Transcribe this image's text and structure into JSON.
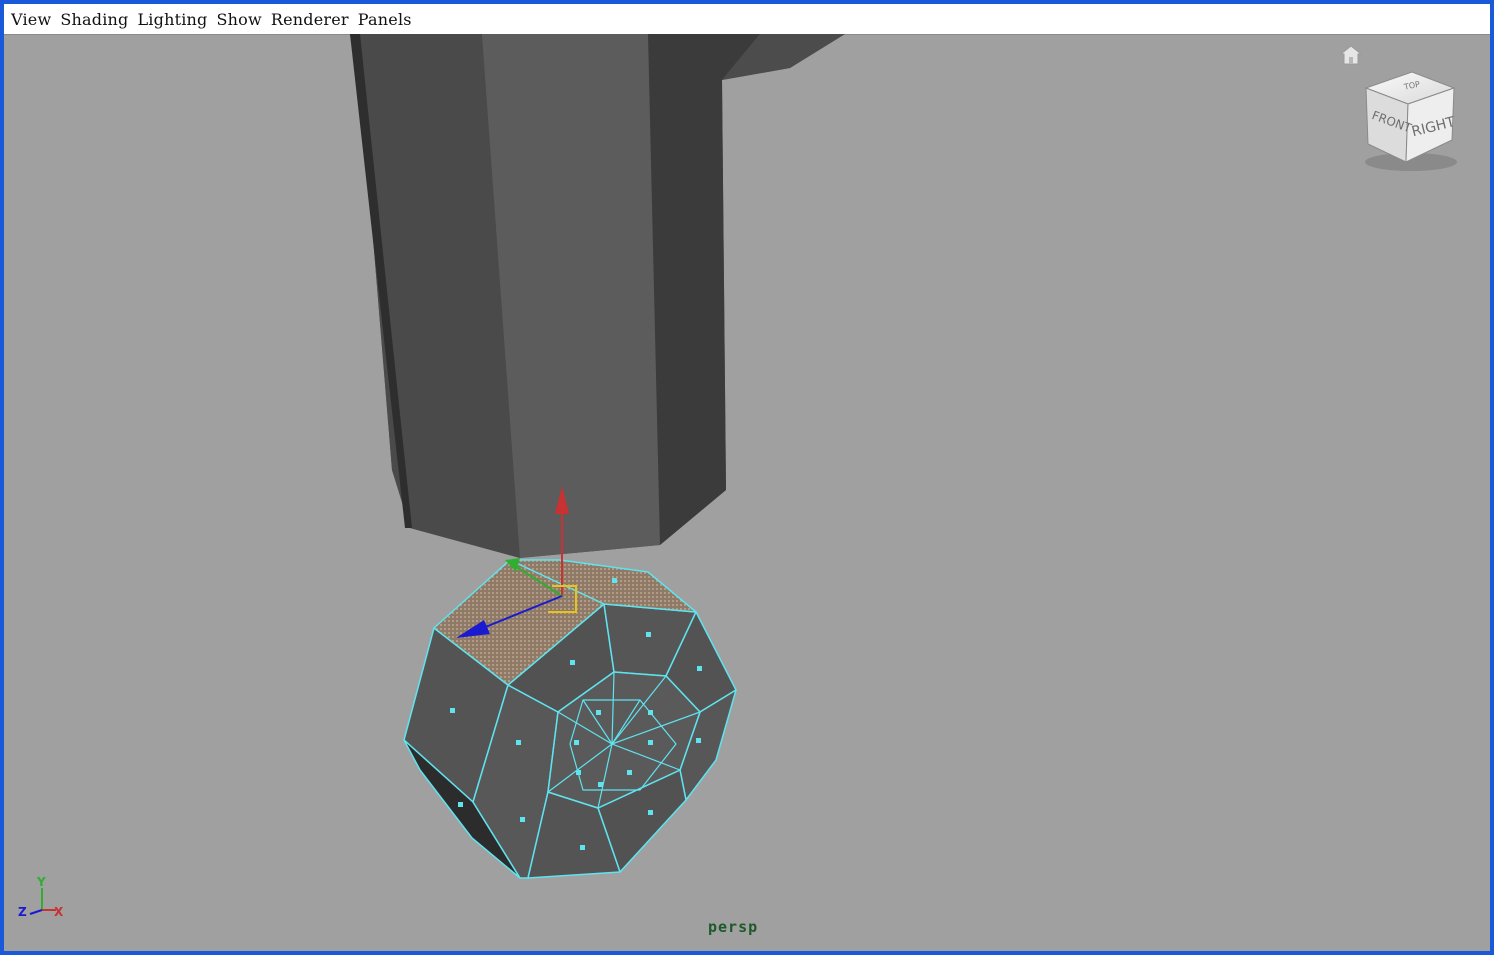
{
  "menubar": {
    "items": [
      "View",
      "Shading",
      "Lighting",
      "Show",
      "Renderer",
      "Panels"
    ]
  },
  "viewport": {
    "camera_name": "persp",
    "background": "#a0a0a0"
  },
  "viewcube": {
    "front_label": "FRONT",
    "right_label": "RIGHT",
    "top_label": "TOP"
  },
  "axis_indicator": {
    "x_label": "X",
    "y_label": "Y",
    "z_label": "Z"
  },
  "colors": {
    "frame_border": "#1a5ad8",
    "wireframe": "#5fe3ef",
    "selected_face": "#9a8672",
    "axis_x": "#c83232",
    "axis_y": "#2fae2f",
    "axis_z": "#1a1ad0",
    "scale_handle": "#e8c41a",
    "camera_label": "#1c5a2a"
  },
  "icons": [
    "home-icon",
    "viewcube-icon",
    "axis-indicator-icon",
    "move-manipulator-icon"
  ]
}
